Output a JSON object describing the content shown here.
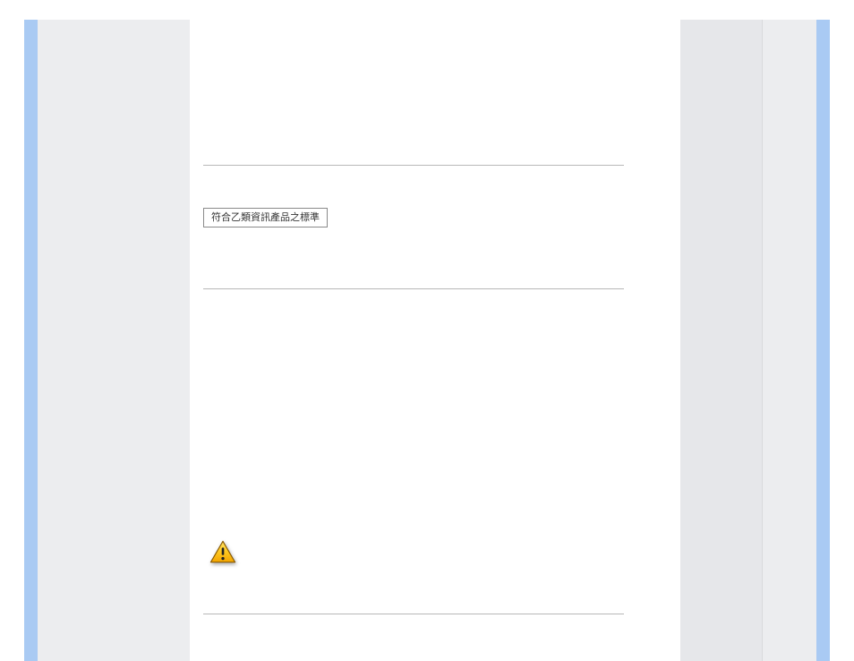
{
  "notice_box": {
    "text": "符合乙類資訊產品之標準"
  },
  "icons": {
    "warning": "warning-triangle"
  }
}
